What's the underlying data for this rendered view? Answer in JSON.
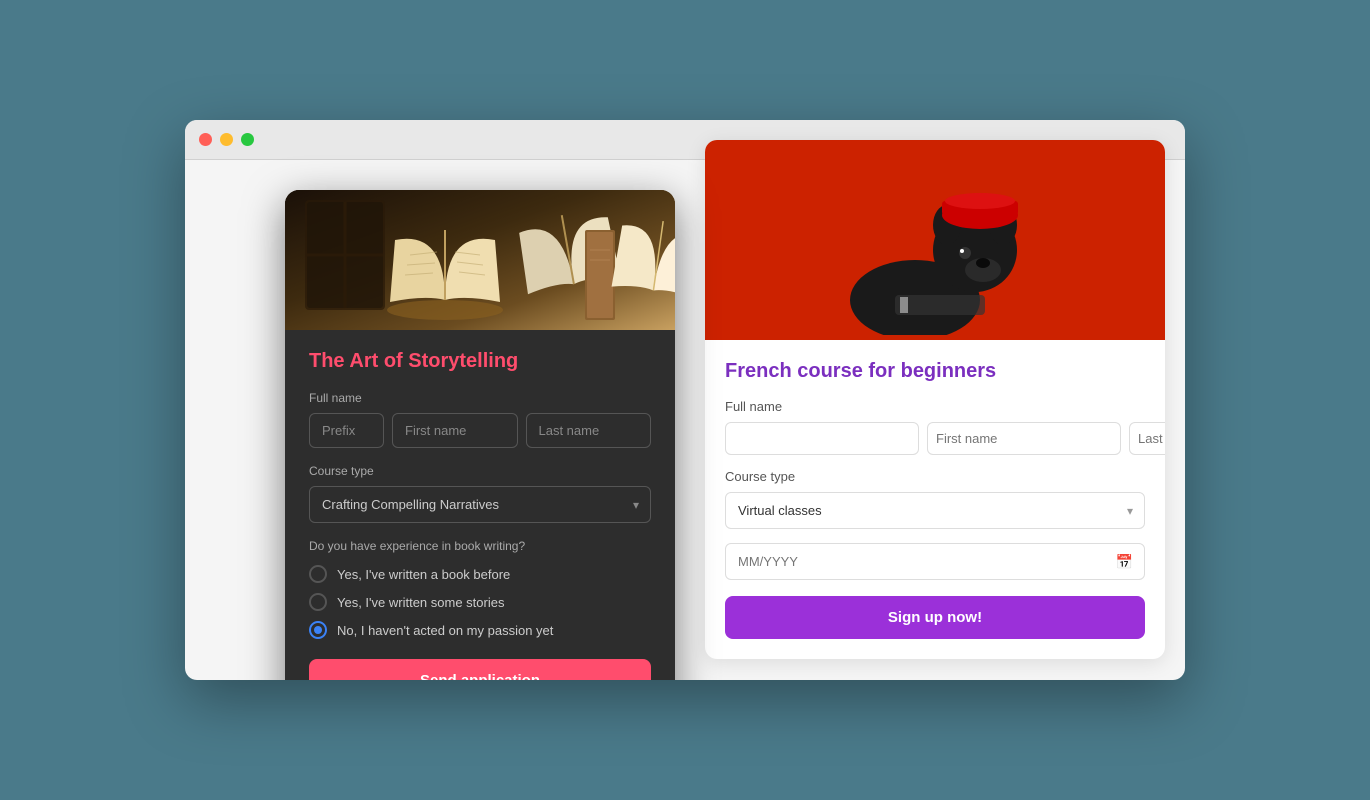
{
  "browser": {
    "traffic_lights": {
      "red": "red",
      "yellow": "yellow",
      "green": "green"
    }
  },
  "bg_card": {
    "title": "nch course for beginners",
    "full_title": "French course for beginners",
    "name_label": "me",
    "full_name_label": "Full name",
    "prefix_placeholder": "",
    "first_name_placeholder": "First name",
    "last_name_placeholder": "Last name",
    "course_type_label": "e type",
    "full_course_type_label": "Course type",
    "course_type_value": "classes",
    "course_type_full": "Virtual classes",
    "date_placeholder": "MM/YYYY",
    "sign_up_btn": "Sign up now!"
  },
  "modal": {
    "title": "The Art of Storytelling",
    "full_name_label": "Full name",
    "prefix_placeholder": "Prefix",
    "first_name_placeholder": "First name",
    "last_name_placeholder": "Last name",
    "course_type_label": "Course type",
    "course_type_value": "Crafting Compelling Narratives",
    "experience_question": "Do you have experience in book writing?",
    "radio_options": [
      {
        "id": "opt1",
        "label": "Yes, I've written a book before",
        "selected": false
      },
      {
        "id": "opt2",
        "label": "Yes, I've written some stories",
        "selected": false
      },
      {
        "id": "opt3",
        "label": "No, I haven't acted on my passion yet",
        "selected": true
      }
    ],
    "submit_btn": "Send application"
  }
}
